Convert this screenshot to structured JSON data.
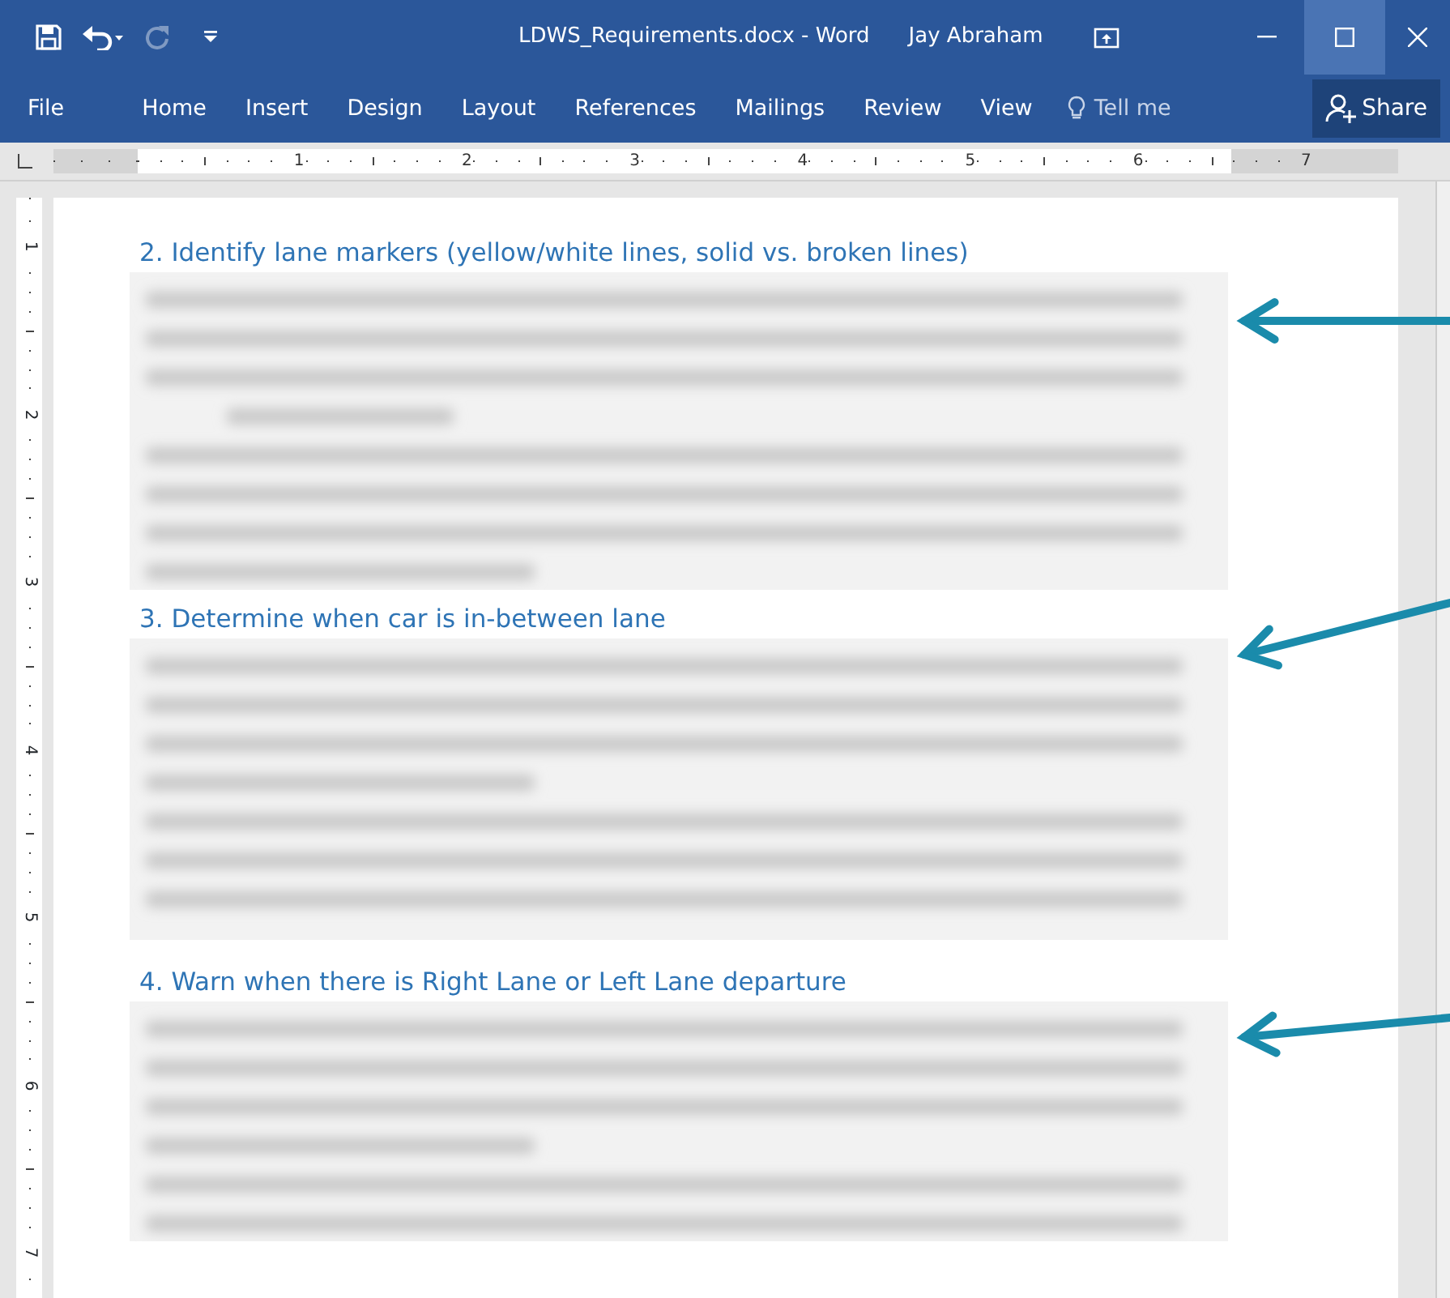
{
  "window": {
    "title": "LDWS_Requirements.docx - Word",
    "user": "Jay Abraham"
  },
  "ribbon_tabs": [
    {
      "label": "File"
    },
    {
      "label": "Home"
    },
    {
      "label": "Insert"
    },
    {
      "label": "Design"
    },
    {
      "label": "Layout"
    },
    {
      "label": "References"
    },
    {
      "label": "Mailings"
    },
    {
      "label": "Review"
    },
    {
      "label": "View"
    }
  ],
  "tell_me": {
    "placeholder": "Tell me"
  },
  "share_button": "Share",
  "redo_disabled": true,
  "horizontal_ruler": [
    "1",
    "2",
    "3",
    "4",
    "5",
    "6",
    "7"
  ],
  "vertical_ruler": [
    "1",
    "2",
    "3",
    "4",
    "5",
    "6",
    "7"
  ],
  "sections": [
    {
      "heading": "2. Identify lane markers (yellow/white lines, solid vs. broken lines)"
    },
    {
      "heading": "3. Determine when car is in-between lane"
    },
    {
      "heading": "4. Warn when there is Right Lane or Left Lane departure"
    }
  ]
}
